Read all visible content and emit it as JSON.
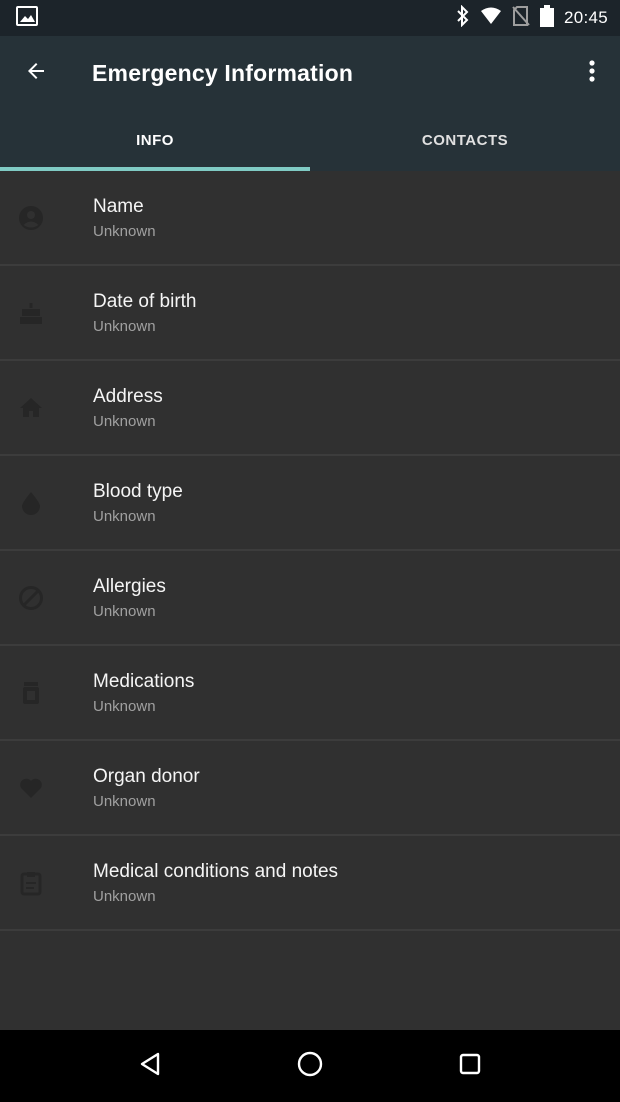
{
  "status_bar": {
    "time": "20:45",
    "icons": [
      "picture-icon",
      "bluetooth-icon",
      "wifi-icon",
      "no-sim-icon",
      "battery-icon"
    ]
  },
  "app_bar": {
    "title": "Emergency Information",
    "back_icon": "back-arrow-icon",
    "overflow_icon": "more-vert-icon"
  },
  "tabs": [
    {
      "label": "INFO",
      "active": true
    },
    {
      "label": "CONTACTS",
      "active": false
    }
  ],
  "accent_color": "#80cbc4",
  "items": [
    {
      "title": "Name",
      "value": "Unknown",
      "icon": "person-icon"
    },
    {
      "title": "Date of birth",
      "value": "Unknown",
      "icon": "cake-icon"
    },
    {
      "title": "Address",
      "value": "Unknown",
      "icon": "home-icon"
    },
    {
      "title": "Blood type",
      "value": "Unknown",
      "icon": "drop-icon"
    },
    {
      "title": "Allergies",
      "value": "Unknown",
      "icon": "block-icon"
    },
    {
      "title": "Medications",
      "value": "Unknown",
      "icon": "pill-bottle-icon"
    },
    {
      "title": "Organ donor",
      "value": "Unknown",
      "icon": "heart-icon"
    },
    {
      "title": "Medical conditions and notes",
      "value": "Unknown",
      "icon": "clipboard-icon"
    }
  ],
  "nav_bar": {
    "buttons": [
      "back-triangle-icon",
      "home-circle-icon",
      "recents-square-icon"
    ]
  }
}
